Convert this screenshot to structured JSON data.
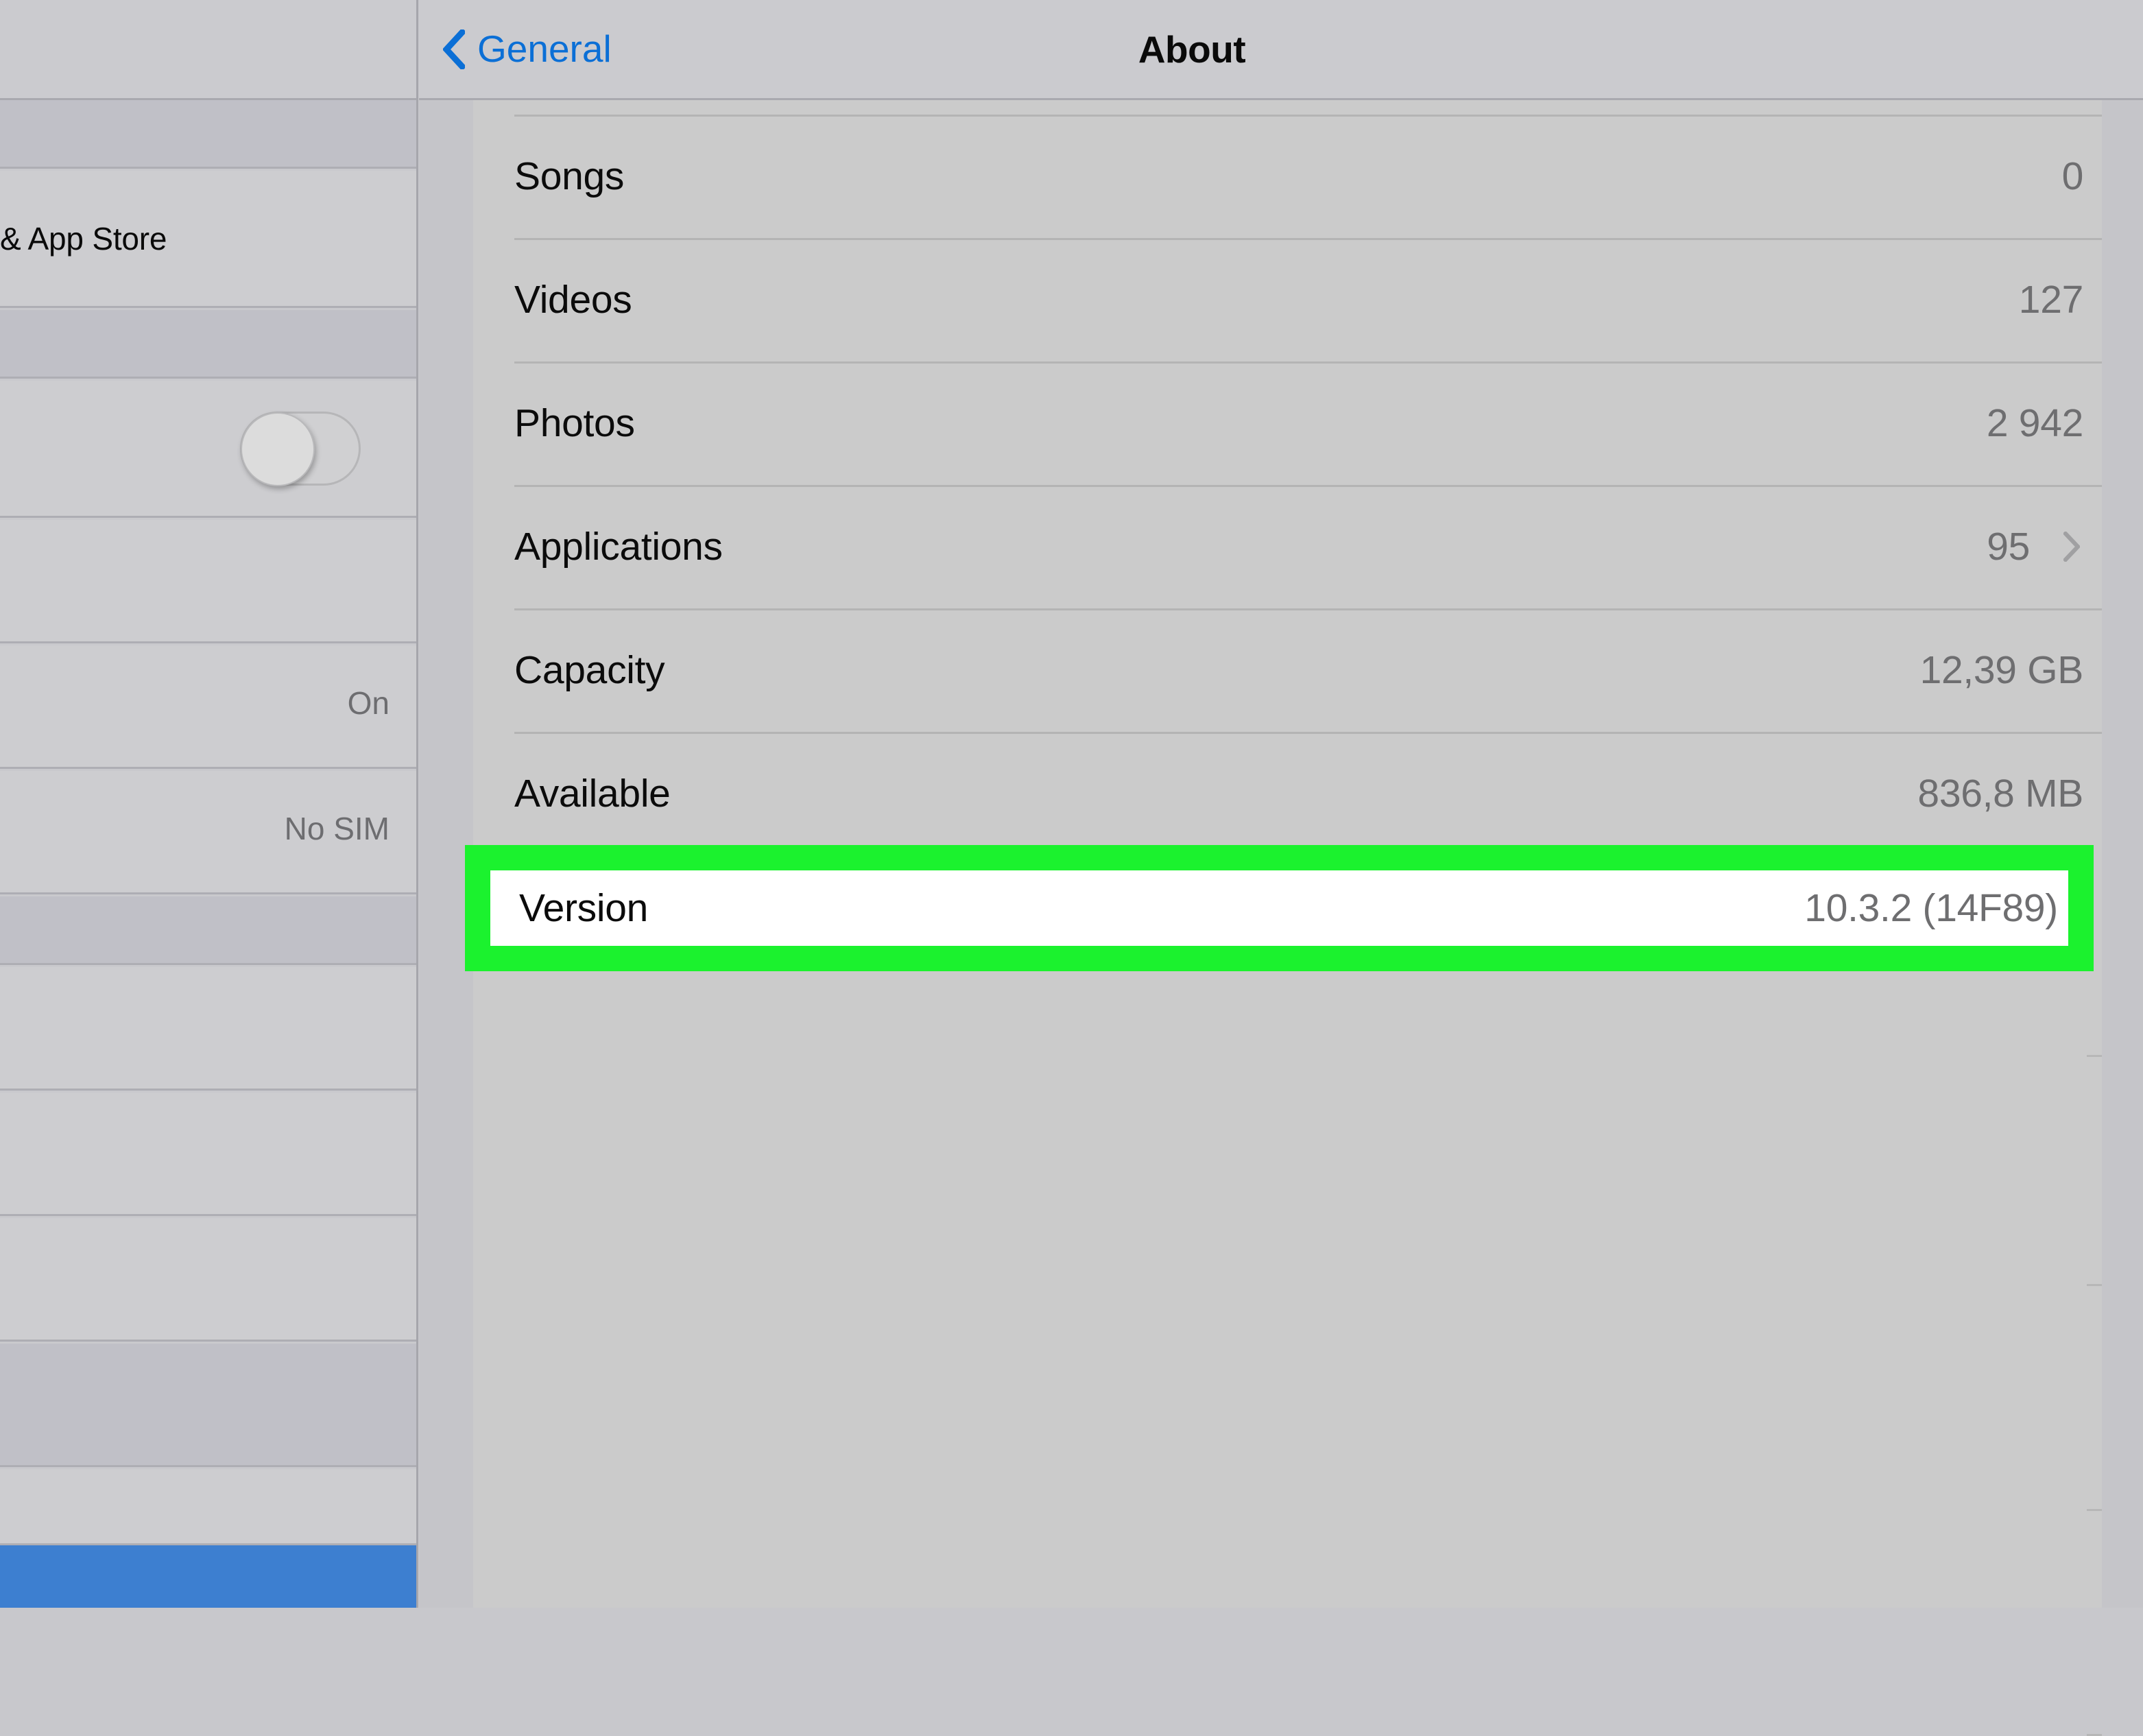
{
  "navbar": {
    "back_label": "General",
    "back_icon": "chevron-left-icon",
    "title": "About"
  },
  "about_list": {
    "rows": [
      {
        "label": "Songs",
        "value": "0",
        "chevron": false
      },
      {
        "label": "Videos",
        "value": "127",
        "chevron": false
      },
      {
        "label": "Photos",
        "value": "2 942",
        "chevron": false
      },
      {
        "label": "Applications",
        "value": "95",
        "chevron": true
      },
      {
        "label": "Capacity",
        "value": "12,39 GB",
        "chevron": false
      },
      {
        "label": "Available",
        "value": "836,8 MB",
        "chevron": false
      }
    ]
  },
  "highlight": {
    "label": "Version",
    "value": "10.3.2 (14F89)",
    "box_color": "#1bf22e",
    "inner_color": "#ffffff"
  },
  "sidebar": {
    "rows": [
      {
        "label": "",
        "value": "",
        "type": "group"
      },
      {
        "label": "& App Store",
        "value": "",
        "type": "item"
      },
      {
        "label": "",
        "value": "",
        "type": "group"
      },
      {
        "label": "",
        "value": "",
        "type": "toggle"
      },
      {
        "label": "",
        "value": "",
        "type": "item"
      },
      {
        "label": "",
        "value": "On",
        "type": "item"
      },
      {
        "label": "",
        "value": "No SIM",
        "type": "item"
      },
      {
        "label": "",
        "value": "",
        "type": "group"
      },
      {
        "label": "",
        "value": "",
        "type": "item"
      },
      {
        "label": "",
        "value": "",
        "type": "item"
      },
      {
        "label": "",
        "value": "",
        "type": "item"
      },
      {
        "label": "",
        "value": "",
        "type": "group"
      }
    ],
    "toggle_state": "off",
    "selected_color": "#3d7fd0"
  },
  "colors": {
    "accent_blue": "#0b6fd6",
    "highlight_green": "#1bf22e",
    "panel_gray": "#cbcbcb",
    "chrome_gray": "#cbcbcf",
    "group_gray": "#c0c0c7"
  }
}
